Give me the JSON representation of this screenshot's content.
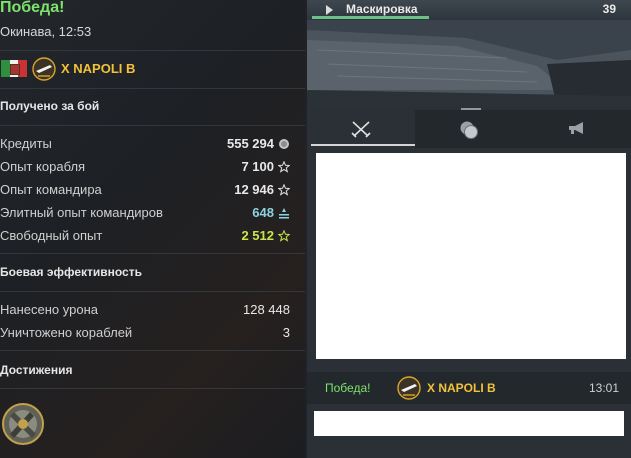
{
  "result": {
    "title": "Победа!",
    "location_time": "Окинава, 12:53",
    "ship": {
      "name": "X NAPOLI B",
      "nation": "italy-flag"
    }
  },
  "earned": {
    "heading": "Получено за бой",
    "rows": [
      {
        "label": "Кредиты",
        "value": "555 294",
        "icon": "credits-icon"
      },
      {
        "label": "Опыт корабля",
        "value": "7 100",
        "icon": "star-icon"
      },
      {
        "label": "Опыт командира",
        "value": "12 946",
        "icon": "star-icon"
      },
      {
        "label": "Элитный опыт командиров",
        "value": "648",
        "icon": "elite-xp-icon"
      },
      {
        "label": "Свободный опыт",
        "value": "2 512",
        "icon": "star-icon"
      }
    ]
  },
  "efficiency": {
    "heading": "Боевая эффективность",
    "rows": [
      {
        "label": "Нанесено урона",
        "value": "128 448"
      },
      {
        "label": "Уничтожено кораблей",
        "value": "3"
      }
    ]
  },
  "achievements": {
    "heading": "Достижения",
    "medal": "achievement-medal-icon"
  },
  "camo": {
    "name": "Маскировка",
    "count": "39",
    "progress": 0.36
  },
  "tabs": [
    {
      "name": "battle-tab",
      "icon": "crossed-swords-icon",
      "active": true
    },
    {
      "name": "coins-tab",
      "icon": "coins-icon",
      "active": false
    },
    {
      "name": "announce-tab",
      "icon": "megaphone-icon",
      "active": false
    }
  ],
  "chat": {
    "message": {
      "result": "Победа!",
      "ship": "X NAPOLI B",
      "time": "13:01"
    },
    "input_value": ""
  },
  "colors": {
    "victory": "#7be36a",
    "ship_name": "#f2c23a",
    "elite_xp": "#8ad3e0",
    "free_xp": "#c8e64a"
  }
}
